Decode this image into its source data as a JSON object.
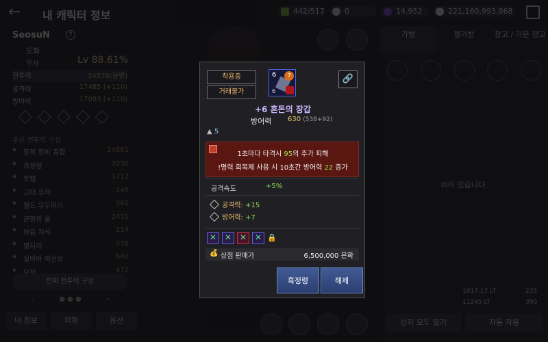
{
  "header": {
    "back": "←",
    "title": "내 캐릭터 정보",
    "currencies": [
      {
        "icon": "stamina-icon",
        "value": "442/517",
        "color": "#7fae3c"
      },
      {
        "icon": "pearl-icon",
        "value": "0",
        "color": "#d9c8c0"
      },
      {
        "icon": "purple-gem-icon",
        "value": "14,952",
        "color": "#8a3ed8"
      },
      {
        "icon": "silver-coin-icon",
        "value": "221,160,993,868",
        "color": "#c8d4e0"
      }
    ]
  },
  "left": {
    "name": "SeosuN",
    "help": "?",
    "guild": "도화",
    "class": "무사",
    "level": "Lv 88.61%",
    "stats": [
      {
        "label": "전투력",
        "value": "34578(용병)"
      },
      {
        "label": "공격력",
        "value": "17485 (+110)"
      },
      {
        "label": "방어력",
        "value": "17093 (+110)"
      }
    ],
    "section_title": "주요 전투력 구성",
    "list": [
      {
        "label": "장착 장비 종합",
        "value": "14861"
      },
      {
        "label": "흑정령",
        "value": "3030"
      },
      {
        "label": "토템",
        "value": "1712"
      },
      {
        "label": "고대 유적",
        "value": "248"
      },
      {
        "label": "월드 우두머리",
        "value": "361"
      },
      {
        "label": "균형의 룸",
        "value": "2410"
      },
      {
        "label": "하듐 지식",
        "value": "214"
      },
      {
        "label": "별자리",
        "value": "278"
      },
      {
        "label": "실비아 여신상",
        "value": "640"
      },
      {
        "label": "요정",
        "value": "472"
      }
    ],
    "full_button": "전체 전투력 구성",
    "pager_left": "‹",
    "pager_dots": "● ● ●",
    "pager_right": "›",
    "tabs": [
      "내 정보",
      "외형",
      "옵션"
    ]
  },
  "right": {
    "tabs": [
      "가방",
      "펄가방",
      "창고 / 가문 창고"
    ],
    "empty": "비어 있습니다.",
    "weight_top": "1017.17 LT",
    "weight_bottom": "11245 LT",
    "count_top": "235",
    "count_bottom": "390",
    "open_all": "상자 모두 열기",
    "auto_equip": "자동 착용"
  },
  "popup": {
    "tag_equipped": "착용중",
    "tag_untradable": "거래불가",
    "item_enh": "6",
    "item_gem": "7",
    "item_bottom": "6",
    "link": "🔗",
    "item_name": "+6 혼돈의 장갑",
    "def_label": "방어력",
    "def_value": "630",
    "def_sub": "(538+92)",
    "weight": "5",
    "effect_1a": "1초마다 타격시 ",
    "effect_1b": "95",
    "effect_1c": "의 추가 피해",
    "effect_2a": "!명력 회복제 사용 시 10초간 방어력 ",
    "effect_2b": "22",
    "effect_2c": " 증가",
    "speed_label": "공격속도",
    "speed_value": "+5%",
    "opt1_label": "공격력: ",
    "opt1_value": "+15",
    "opt2_label": "방어력: ",
    "opt2_value": "+7",
    "lock": "🔒",
    "sell_icon": "💰",
    "sell_label": "상점 판매가",
    "sell_value": "6,500,000 은화",
    "btn_spirit": "흑정령",
    "btn_release": "해제"
  }
}
